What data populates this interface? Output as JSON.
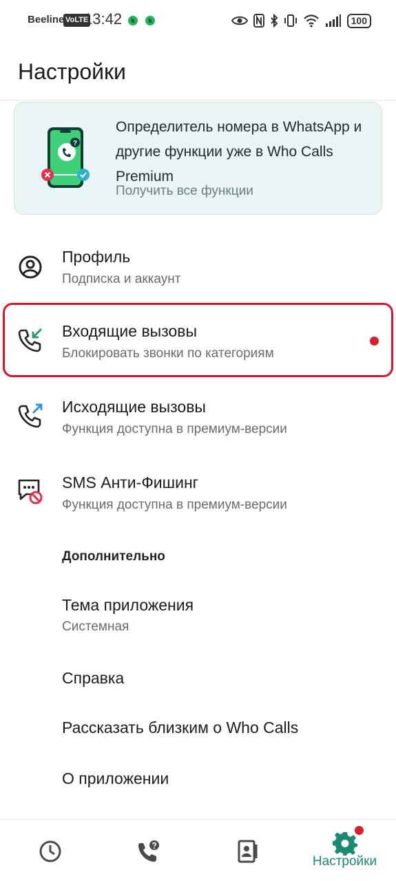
{
  "status_bar": {
    "carrier": "Beeline",
    "network_badge": "VoLTE",
    "time": "13:42",
    "app_badges": [
      "k",
      "k"
    ],
    "battery": "100"
  },
  "header": {
    "title": "Настройки"
  },
  "promo": {
    "text": "Определитель номера в WhatsApp и другие функции уже в Who Calls Premium",
    "link": "Получить все функции",
    "badge": "?"
  },
  "menu": [
    {
      "title": "Профиль",
      "subtitle": "Подписка и аккаунт",
      "icon": "account-circle-icon"
    },
    {
      "title": "Входящие вызовы",
      "subtitle": "Блокировать звонки по категориям",
      "icon": "incoming-call-icon",
      "highlighted": true,
      "notification_dot": true
    },
    {
      "title": "Исходящие вызовы",
      "subtitle": "Функция доступна в премиум-версии",
      "icon": "outgoing-call-icon"
    },
    {
      "title": "SMS Анти-Фишинг",
      "subtitle": "Функция доступна в премиум-версии",
      "icon": "sms-block-icon"
    }
  ],
  "additional": {
    "header": "Дополнительно",
    "items": [
      {
        "title": "Тема приложения",
        "subtitle": "Системная"
      },
      {
        "title": "Справка"
      },
      {
        "title": "Рассказать близким о Who Calls"
      },
      {
        "title": "О приложении"
      }
    ]
  },
  "bottom_nav": {
    "items": [
      {
        "icon": "clock-icon"
      },
      {
        "icon": "call-question-icon"
      },
      {
        "icon": "contacts-icon"
      },
      {
        "icon": "gear-icon",
        "label": "Настройки",
        "active": true,
        "notification_dot": true
      }
    ]
  },
  "colors": {
    "accent": "#1a8a73",
    "promo_background": "#e9f4f4",
    "highlight_border": "#e3102a",
    "notification_dot": "#d8202f",
    "incoming_arrow": "#1a9a6e",
    "outgoing_arrow": "#2d8ee8"
  }
}
